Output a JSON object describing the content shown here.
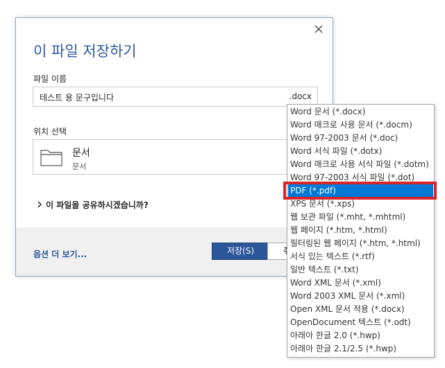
{
  "dialog": {
    "title": "이 파일 저장하기",
    "filename_label": "파일 이름",
    "filename_value": "테스트 용 문구입니다",
    "filename_ext": ".docx",
    "location_label": "위치 선택",
    "location_name": "문서",
    "location_path": "문서",
    "share_text": "이 파일을 공유하시겠습니까?",
    "more_options": "옵션 더 보기...",
    "save_label": "저장(S)",
    "cancel_label": "취"
  },
  "file_types": [
    "Word 문서 (*.docx)",
    "Word 매크로 사용 문서 (*.docm)",
    "Word 97-2003 문서 (*.doc)",
    "Word 서식 파일 (*.dotx)",
    "Word 매크로 사용 서식 파일 (*.dotm)",
    "Word 97-2003 서식 파일 (*.dot)",
    "PDF (*.pdf)",
    "XPS 문서 (*.xps)",
    "웹 보관 파일 (*.mht, *.mhtml)",
    "웹 페이지 (*.htm, *.html)",
    "필터링된 웹 페이지 (*.htm, *.html)",
    "서식 있는 텍스트 (*.rtf)",
    "일반 텍스트 (*.txt)",
    "Word XML 문서 (*.xml)",
    "Word 2003 XML 문서 (*.xml)",
    "Open XML 문서 적용 (*.docx)",
    "OpenDocument 텍스트 (*.odt)",
    "아래아 한글 2.0 (*.hwp)",
    "아래아 한글 2.1/2.5 (*.hwp)"
  ],
  "selected_file_type_index": 6,
  "colors": {
    "accent": "#2b579a",
    "selection": "#0078d7",
    "highlight_frame": "#d9242a"
  },
  "icons": {
    "close": "close-icon",
    "folder": "folder-icon",
    "share_chevron": "chevron-right-icon"
  }
}
